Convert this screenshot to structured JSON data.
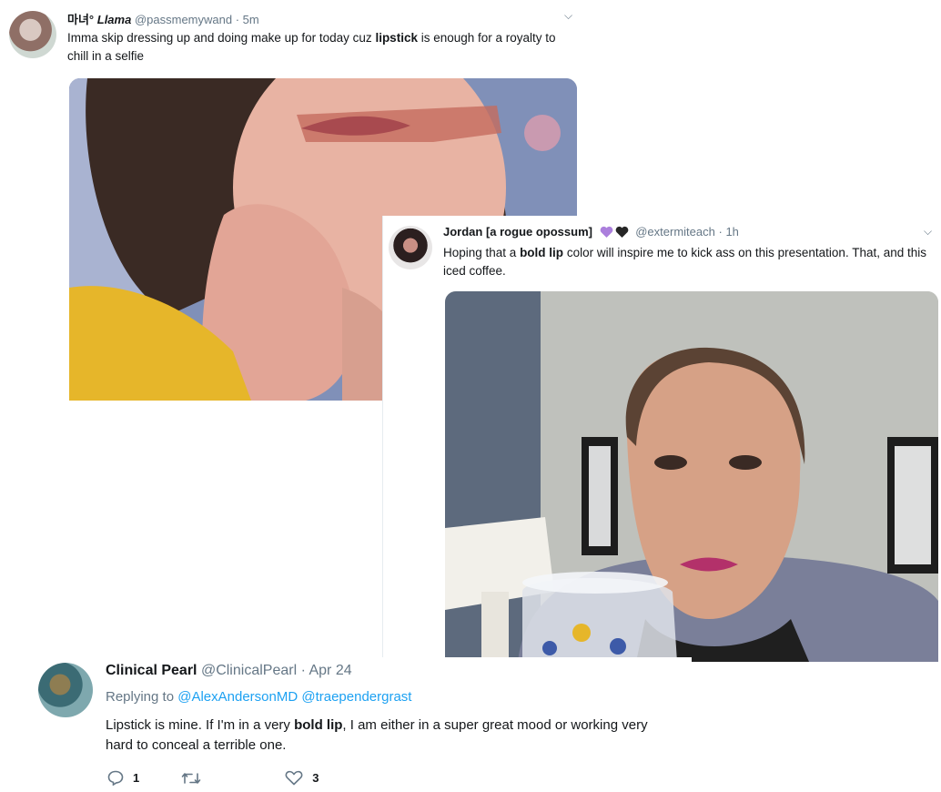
{
  "tweet1": {
    "display_name_prefix": "마녀°",
    "display_name": "Llama",
    "handle": "@passmemywand",
    "time": "5m",
    "text_before": "Imma skip dressing up and doing make up for today cuz ",
    "text_bold": "lipstick",
    "text_after": " is enough for a royalty to chill in a selfie",
    "colors": {
      "photo_bg": "#7f8fb5",
      "shirt": "#e6b62a",
      "skin": "#e7b2a5"
    }
  },
  "tweet2": {
    "display_name": "Jordan [a rogue opossum]",
    "emoji": [
      "purple-heart",
      "black-heart"
    ],
    "handle": "@extermiteach",
    "time": "1h",
    "text_before": "Hoping that a ",
    "text_bold": "bold lip",
    "text_after": " color will inspire me to kick ass on this presentation. That, and this iced coffee.",
    "colors": {
      "purple_heart": "#ab7fdc",
      "black_heart": "#262626"
    }
  },
  "tweet3": {
    "display_name": "Clinical Pearl",
    "handle": "@ClinicalPearl",
    "time": "Apr 24",
    "replying_label": "Replying to",
    "reply_to_1": "@AlexAndersonMD",
    "reply_to_2": "@traependergrast",
    "text_before": "Lipstick is mine. If I'm in a very ",
    "text_bold": "bold lip",
    "text_after": ", I am either in a super great mood or working very hard to conceal a terrible one.",
    "reply_count": "1",
    "like_count": "3",
    "colors": {
      "link": "#1da1f2",
      "muted": "#657786"
    }
  },
  "separator": "·",
  "chevron": "⌵"
}
